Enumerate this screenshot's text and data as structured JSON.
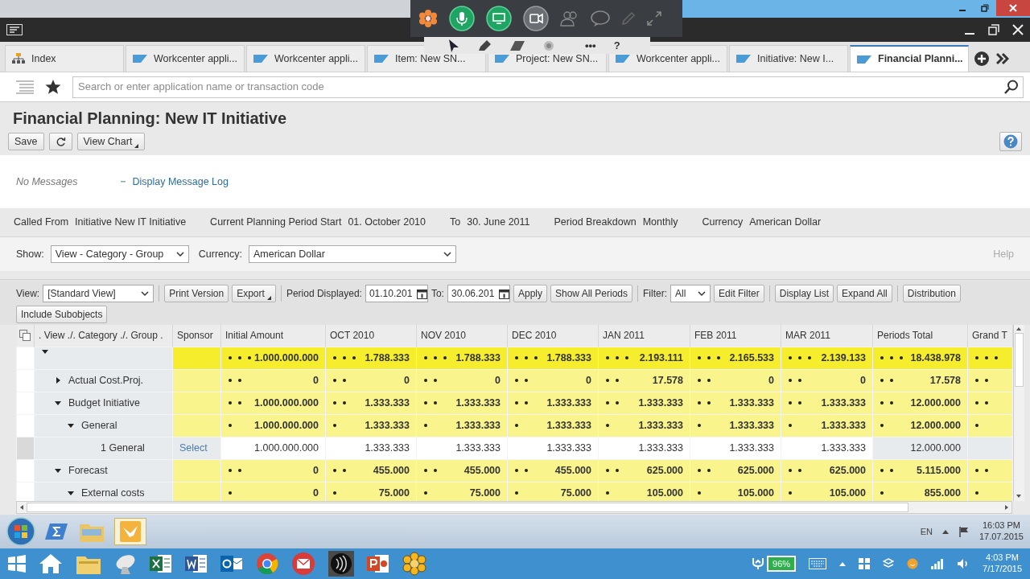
{
  "meeting_toolbar": {
    "more": "•••",
    "help": "?"
  },
  "tabs": [
    {
      "label": "Index",
      "kind": "index",
      "selected": false
    },
    {
      "label": "Workcenter appli...",
      "kind": "app",
      "selected": false
    },
    {
      "label": "Workcenter appli...",
      "kind": "app",
      "selected": false
    },
    {
      "label": "Item: New SN...",
      "kind": "app",
      "selected": false
    },
    {
      "label": "Project: New SN...",
      "kind": "app",
      "selected": false
    },
    {
      "label": "Workcenter appli...",
      "kind": "app",
      "selected": false
    },
    {
      "label": "Initiative: New I...",
      "kind": "app",
      "selected": false
    },
    {
      "label": "Financial Planni...",
      "kind": "app",
      "selected": true
    }
  ],
  "search": {
    "placeholder": "Search or enter application name or transaction code"
  },
  "page": {
    "title": "Financial Planning: New IT Initiative",
    "buttons": [
      {
        "kind": "text",
        "label": "Save"
      },
      {
        "kind": "refresh"
      },
      {
        "kind": "menu",
        "label": "View Chart"
      }
    ]
  },
  "messages": {
    "status": "No Messages",
    "link": "Display Message Log"
  },
  "context": [
    {
      "label": "Called From",
      "value": "Initiative New IT Initiative"
    },
    {
      "label": "Current Planning Period Start",
      "value": "01. October 2010"
    },
    {
      "label": "To",
      "value": "30. June 2011"
    },
    {
      "label": "Period Breakdown",
      "value": "Monthly"
    },
    {
      "label": "Currency",
      "value": "American Dollar"
    }
  ],
  "filters": {
    "show_label": "Show:",
    "show_value": "View - Category - Group",
    "currency_label": "Currency:",
    "currency_value": "American Dollar",
    "help": "Help"
  },
  "toolbar": [
    {
      "kind": "select",
      "label": "View:",
      "value": "[Standard View]"
    },
    {
      "kind": "separator"
    },
    {
      "kind": "button",
      "label": "Print Version"
    },
    {
      "kind": "menu",
      "label": "Export"
    },
    {
      "kind": "separator"
    },
    {
      "kind": "date",
      "label": "Period Displayed:",
      "value": "01.10.201"
    },
    {
      "kind": "date",
      "label": "To:",
      "value": "30.06.201"
    },
    {
      "kind": "button",
      "label": "Apply"
    },
    {
      "kind": "button",
      "label": "Show All Periods"
    },
    {
      "kind": "separator"
    },
    {
      "kind": "select",
      "label": "Filter:",
      "value": "All"
    },
    {
      "kind": "button",
      "label": "Edit Filter"
    },
    {
      "kind": "separator"
    },
    {
      "kind": "button",
      "label": "Display List"
    },
    {
      "kind": "button",
      "label": "Expand All"
    },
    {
      "kind": "separator"
    },
    {
      "kind": "button",
      "label": "Distribution"
    },
    {
      "kind": "button",
      "label": "Include Subobjects"
    }
  ],
  "table": {
    "columns": [
      ". View ./. Category ./. Group .",
      "Sponsor",
      "Initial Amount",
      "OCT 2010",
      "NOV 2010",
      "DEC 2010",
      "JAN 2011",
      "FEB 2011",
      "MAR 2011",
      "Periods Total",
      "Grand T"
    ],
    "rows": [
      {
        "kind": "summary",
        "expanded": true,
        "selected": false,
        "values": [
          "1.000.000.000",
          "1.788.333",
          "1.788.333",
          "1.788.333",
          "2.193.111",
          "2.165.533",
          "2.139.133",
          "18.438.978"
        ],
        "children": [
          {
            "kind": "subtotal",
            "label": "Actual Cost.Proj.",
            "expanded": false,
            "selected": false,
            "values": [
              "0",
              "0",
              "0",
              "0",
              "17.578",
              "0",
              "0",
              "17.578"
            ]
          },
          {
            "kind": "subtotal",
            "label": "Budget Initiative",
            "expanded": true,
            "selected": false,
            "values": [
              "1.000.000.000",
              "1.333.333",
              "1.333.333",
              "1.333.333",
              "1.333.333",
              "1.333.333",
              "1.333.333",
              "12.000.000"
            ],
            "children": [
              {
                "kind": "subtotal",
                "label": "General",
                "expanded": true,
                "selected": false,
                "values": [
                  "1.000.000.000",
                  "1.333.333",
                  "1.333.333",
                  "1.333.333",
                  "1.333.333",
                  "1.333.333",
                  "1.333.333",
                  "12.000.000"
                ],
                "children": [
                  {
                    "kind": "item",
                    "label": "1 General",
                    "sponsor": "Select",
                    "selected": true,
                    "values": [
                      "1.000.000.000",
                      "1.333.333",
                      "1.333.333",
                      "1.333.333",
                      "1.333.333",
                      "1.333.333",
                      "1.333.333",
                      "12.000.000"
                    ]
                  }
                ]
              }
            ]
          },
          {
            "kind": "subtotal",
            "label": "Forecast",
            "expanded": true,
            "selected": false,
            "values": [
              "0",
              "455.000",
              "455.000",
              "455.000",
              "625.000",
              "625.000",
              "625.000",
              "5.115.000"
            ],
            "children": [
              {
                "kind": "subtotal",
                "label": "External costs",
                "expanded": true,
                "selected": false,
                "values": [
                  "0",
                  "75.000",
                  "75.000",
                  "75.000",
                  "105.000",
                  "105.000",
                  "105.000",
                  "855.000"
                ]
              }
            ]
          }
        ]
      }
    ]
  },
  "taskbar_top": {
    "language": "EN",
    "time": "16:03 PM",
    "date": "17.07.2015"
  },
  "taskbar_bottom": {
    "battery": "96%",
    "time": "4:03 PM",
    "date": "7/17/2015"
  }
}
